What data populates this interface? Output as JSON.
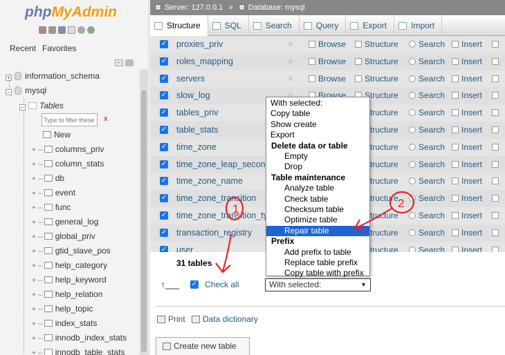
{
  "nav": {
    "logo_php": "php",
    "logo_ma": "MyAdmin",
    "recent": "Recent",
    "favorites": "Favorites",
    "tree": {
      "information_schema": "information_schema",
      "mysql": "mysql",
      "tables": "Tables",
      "filter_placeholder": "Type to filter these",
      "filter_clear": "x",
      "new": "New",
      "tables_list": [
        "columns_priv",
        "column_stats",
        "db",
        "event",
        "func",
        "general_log",
        "global_priv",
        "gtid_slave_pos",
        "help_category",
        "help_keyword",
        "help_relation",
        "help_topic",
        "index_stats",
        "innodb_index_stats",
        "innodb_table_stats"
      ]
    }
  },
  "breadcrumb": {
    "server": "Server: 127.0.0.1",
    "sep": "»",
    "database": "Database: mysql"
  },
  "tabs": [
    "Structure",
    "SQL",
    "Search",
    "Query",
    "Export",
    "Import"
  ],
  "table_rows": [
    {
      "name": "proxies_priv"
    },
    {
      "name": "roles_mapping"
    },
    {
      "name": "servers"
    },
    {
      "name": "slow_log"
    },
    {
      "name": "tables_priv"
    },
    {
      "name": "table_stats"
    },
    {
      "name": "time_zone"
    },
    {
      "name": "time_zone_leap_second"
    },
    {
      "name": "time_zone_name"
    },
    {
      "name": "time_zone_transition"
    },
    {
      "name": "time_zone_transition_type"
    },
    {
      "name": "transaction_registry"
    },
    {
      "name": "user"
    }
  ],
  "actions": {
    "browse": "Browse",
    "structure": "Structure",
    "search": "Search",
    "insert": "Insert"
  },
  "footer": {
    "count": "31 tables",
    "check_all": "Check all",
    "with_selected": "With selected:",
    "print": "Print",
    "data_dictionary": "Data dictionary",
    "create_new_table": "Create new table"
  },
  "dropdown": {
    "items": [
      {
        "label": "With selected:",
        "kind": "plain"
      },
      {
        "label": "Copy table",
        "kind": "plain"
      },
      {
        "label": "Show create",
        "kind": "plain"
      },
      {
        "label": "Export",
        "kind": "plain"
      },
      {
        "label": "Delete data or table",
        "kind": "head"
      },
      {
        "label": "Empty",
        "kind": "indent"
      },
      {
        "label": "Drop",
        "kind": "indent"
      },
      {
        "label": "Table maintenance",
        "kind": "head"
      },
      {
        "label": "Analyze table",
        "kind": "indent"
      },
      {
        "label": "Check table",
        "kind": "indent"
      },
      {
        "label": "Checksum table",
        "kind": "indent"
      },
      {
        "label": "Optimize table",
        "kind": "indent"
      },
      {
        "label": "Repair table",
        "kind": "indent",
        "selected": true
      },
      {
        "label": "Prefix",
        "kind": "head"
      },
      {
        "label": "Add prefix to table",
        "kind": "indent"
      },
      {
        "label": "Replace table prefix",
        "kind": "indent"
      },
      {
        "label": "Copy table with prefix",
        "kind": "indent"
      }
    ]
  },
  "annotations": {
    "one": "1",
    "two": "2"
  },
  "colors": {
    "link": "#235a81",
    "selected": "#1e64d6",
    "annotation": "#e8202a"
  }
}
